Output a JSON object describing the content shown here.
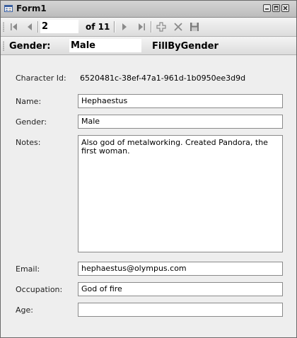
{
  "window": {
    "title": "Form1"
  },
  "navigator": {
    "position": "2",
    "count_text": "of 11",
    "buttons": [
      "move-first",
      "move-previous",
      "move-next",
      "move-last",
      "add-new",
      "delete",
      "save"
    ]
  },
  "query": {
    "label": "Gender:",
    "value": "Male",
    "button_label": "FillByGender"
  },
  "form": {
    "character_id_label": "Character Id:",
    "character_id_value": "6520481c-38ef-47a1-961d-1b0950ee3d9d",
    "name_label": "Name:",
    "name_value": "Hephaestus",
    "gender_label": "Gender:",
    "gender_value": "Male",
    "notes_label": "Notes:",
    "notes_value": "Also god of metalworking.  Created Pandora, the first woman.",
    "email_label": "Email:",
    "email_value": "hephaestus@olympus.com",
    "occupation_label": "Occupation:",
    "occupation_value": "God of fire",
    "age_label": "Age:",
    "age_value": ""
  },
  "colors": {
    "accent_blue": "#3a5f9f",
    "toolbar": "#e4e4e4"
  }
}
